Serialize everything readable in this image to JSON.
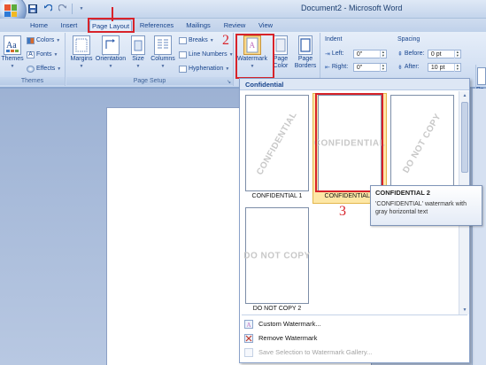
{
  "window": {
    "title": "Document2 - Microsoft Word"
  },
  "tabs": [
    {
      "label": "Home"
    },
    {
      "label": "Insert"
    },
    {
      "label": "Page Layout",
      "active": true
    },
    {
      "label": "References"
    },
    {
      "label": "Mailings"
    },
    {
      "label": "Review"
    },
    {
      "label": "View"
    }
  ],
  "ribbon": {
    "themes": {
      "big_label": "Themes",
      "colors": "Colors",
      "fonts": "Fonts",
      "effects": "Effects",
      "group_label": "Themes"
    },
    "page_setup": {
      "margins": "Margins",
      "orientation": "Orientation",
      "size": "Size",
      "columns": "Columns",
      "breaks": "Breaks",
      "line_numbers": "Line Numbers",
      "hyphenation": "Hyphenation",
      "group_label": "Page Setup"
    },
    "page_background": {
      "watermark": "Watermark",
      "page_color_1": "Page",
      "page_color_2": "Color",
      "page_borders_1": "Page",
      "page_borders_2": "Borders"
    },
    "indent": {
      "header": "Indent",
      "left_label": "Left:",
      "left_value": "0\"",
      "right_label": "Right:",
      "right_value": "0\""
    },
    "spacing": {
      "header": "Spacing",
      "before_label": "Before:",
      "before_value": "0 pt",
      "after_label": "After:",
      "after_value": "10 pt"
    },
    "arrange_partial": "Po"
  },
  "gallery": {
    "section_header": "Confidential",
    "items": [
      {
        "label": "CONFIDENTIAL 1",
        "watermark": "CONFIDENTIAL",
        "style": "diagonal"
      },
      {
        "label": "CONFIDENTIAL 2",
        "watermark": "CONFIDENTIAL",
        "style": "horizontal"
      },
      {
        "label": "",
        "watermark": "DO NOT COPY",
        "style": "diagonal"
      },
      {
        "label": "DO NOT COPY 2",
        "watermark": "DO NOT COPY",
        "style": "horizontal"
      }
    ],
    "menu": [
      {
        "label": "Custom Watermark...",
        "enabled": true
      },
      {
        "label": "Remove Watermark",
        "enabled": true
      },
      {
        "label": "Save Selection to Watermark Gallery...",
        "enabled": false
      }
    ]
  },
  "tooltip": {
    "title": "CONFIDENTIAL 2",
    "description": "'CONFIDENTIAL' watermark with gray horizontal text"
  },
  "steps": {
    "two": "2",
    "three": "3"
  },
  "colors": {
    "annotation_red": "#d8232a",
    "ribbon_text": "#15428b",
    "hover_fill": "#fde7a6"
  }
}
